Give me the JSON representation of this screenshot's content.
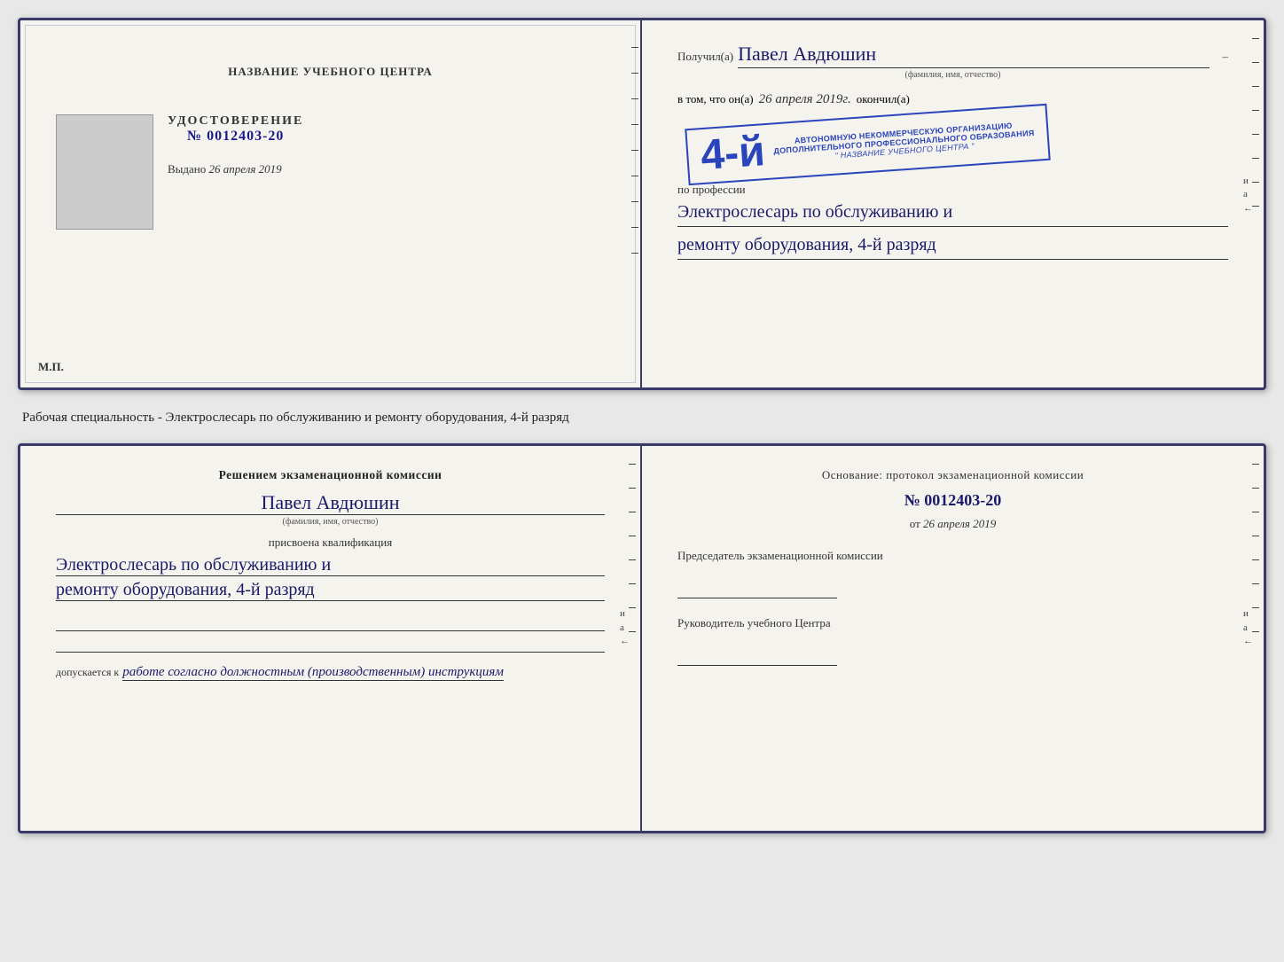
{
  "doc1": {
    "left": {
      "title": "НАЗВАНИЕ УЧЕБНОГО ЦЕНТРА",
      "udostoverenie_label": "УДОСТОВЕРЕНИЕ",
      "number": "№ 0012403-20",
      "vydano_prefix": "Выдано",
      "vydano_date": "26 апреля 2019",
      "mp": "М.П."
    },
    "right": {
      "poluchil_prefix": "Получил(a)",
      "name": "Павел Авдюшин",
      "fio_label": "(фамилия, имя, отчество)",
      "vtom_prefix": "в том, что он(а)",
      "vtom_date": "26 апреля 2019г.",
      "okonchil": "окончил(а)",
      "stamp": {
        "rank": "4-й",
        "line1": "АВТОНОМНУЮ НЕКОММЕРЧЕСКУЮ ОРГАНИЗАЦИЮ",
        "line2": "ДОПОЛНИТЕЛЬНОГО ПРОФЕССИОНАЛЬНОГО ОБРАЗОВАНИЯ",
        "line3": "\" НАЗВАНИЕ УЧЕБНОГО ЦЕНТРА \""
      },
      "po_professii": "по профессии",
      "profession_line1": "Электрослесарь по обслуживанию и",
      "profession_line2": "ремонту оборудования, 4-й разряд"
    }
  },
  "caption": "Рабочая специальность - Электрослесарь по обслуживанию и ремонту оборудования, 4-й разряд",
  "doc2": {
    "left": {
      "resheniem_title": "Решением экзаменационной комиссии",
      "name": "Павел Авдюшин",
      "fio_label": "(фамилия, имя, отчество)",
      "prisvoena": "присвоена квалификация",
      "qual_line1": "Электрослесарь по обслуживанию и",
      "qual_line2": "ремонту оборудования, 4-й разряд",
      "dopuskaetsya_prefix": "допускается к",
      "dopuskaetsya_text": "работе согласно должностным (производственным) инструкциям"
    },
    "right": {
      "osnovanie": "Основание: протокол экзаменационной комиссии",
      "number": "№ 0012403-20",
      "ot_prefix": "от",
      "ot_date": "26 апреля 2019",
      "predsedatel_title": "Председатель экзаменационной комиссии",
      "rukovoditel_title": "Руководитель учебного Центра"
    }
  }
}
